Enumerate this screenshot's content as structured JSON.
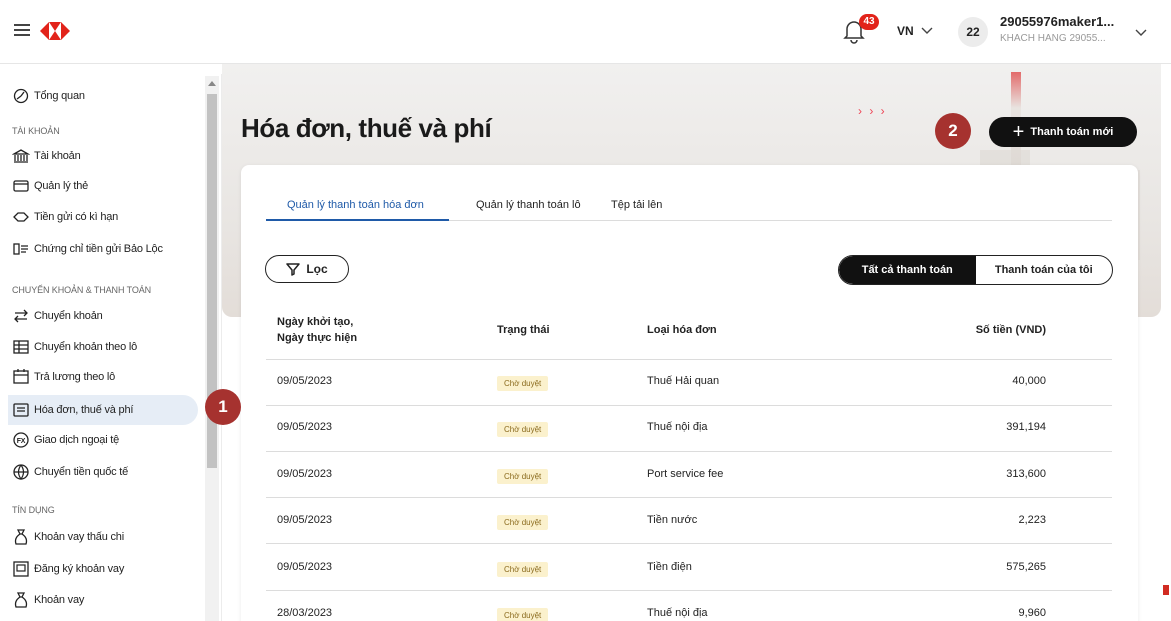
{
  "header": {
    "notification_count": "43",
    "language": "VN",
    "avatar_initials": "22",
    "user_name": "29055976maker1...",
    "user_sub": "KHACH HANG 29055..."
  },
  "sidebar": {
    "overview": "Tổng quan",
    "section_accounts": "TÀI KHOẢN",
    "accounts": "Tài khoản",
    "cards": "Quản lý thẻ",
    "term_deposit": "Tiền gửi có kì hạn",
    "certificate": "Chứng chỉ tiền gửi Bảo Lộc",
    "section_transfer": "CHUYỂN KHOẢN & THANH TOÁN",
    "transfer": "Chuyển khoản",
    "batch_transfer": "Chuyển khoản theo lô",
    "batch_payroll": "Trả lương theo lô",
    "bills": "Hóa đơn, thuế và phí",
    "fx": "Giao dịch ngoại tệ",
    "intl_transfer": "Chuyển tiền quốc tế",
    "section_credit": "TÍN DỤNG",
    "overdraft": "Khoản vay thấu chi",
    "loan_register": "Đăng ký khoản vay",
    "loans": "Khoản vay"
  },
  "main": {
    "title": "Hóa đơn, thuế và phí",
    "new_payment": "Thanh toán mới",
    "tabs": [
      "Quản lý thanh toán hóa đơn",
      "Quản lý thanh toán lô",
      "Tệp tải lên"
    ],
    "filter": "Lọc",
    "seg_all": "Tất cả thanh toán",
    "seg_mine": "Thanh toán của tôi",
    "columns": {
      "date_line1": "Ngày khởi tạo,",
      "date_line2": "Ngày thực hiện",
      "status": "Trạng thái",
      "type": "Loại hóa đơn",
      "amount": "Số tiền (VND)"
    },
    "rows": [
      {
        "date": "09/05/2023",
        "status": "Chờ duyệt",
        "type": "Thuế Hải quan",
        "amount": "40,000"
      },
      {
        "date": "09/05/2023",
        "status": "Chờ duyệt",
        "type": "Thuế nội địa",
        "amount": "391,194"
      },
      {
        "date": "09/05/2023",
        "status": "Chờ duyệt",
        "type": "Port service fee",
        "amount": "313,600"
      },
      {
        "date": "09/05/2023",
        "status": "Chờ duyệt",
        "type": "Tiền nước",
        "amount": "2,223"
      },
      {
        "date": "09/05/2023",
        "status": "Chờ duyệt",
        "type": "Tiền điện",
        "amount": "575,265"
      },
      {
        "date": "28/03/2023",
        "status": "Chờ duyệt",
        "type": "Thuế nội địa",
        "amount": "9,960"
      }
    ]
  },
  "callouts": {
    "one": "1",
    "two": "2"
  },
  "colors": {
    "brand_red": "#e2231a",
    "accent_blue": "#1f5aa8",
    "callout": "#a6322f",
    "badge_bg": "#fbf1cd"
  }
}
